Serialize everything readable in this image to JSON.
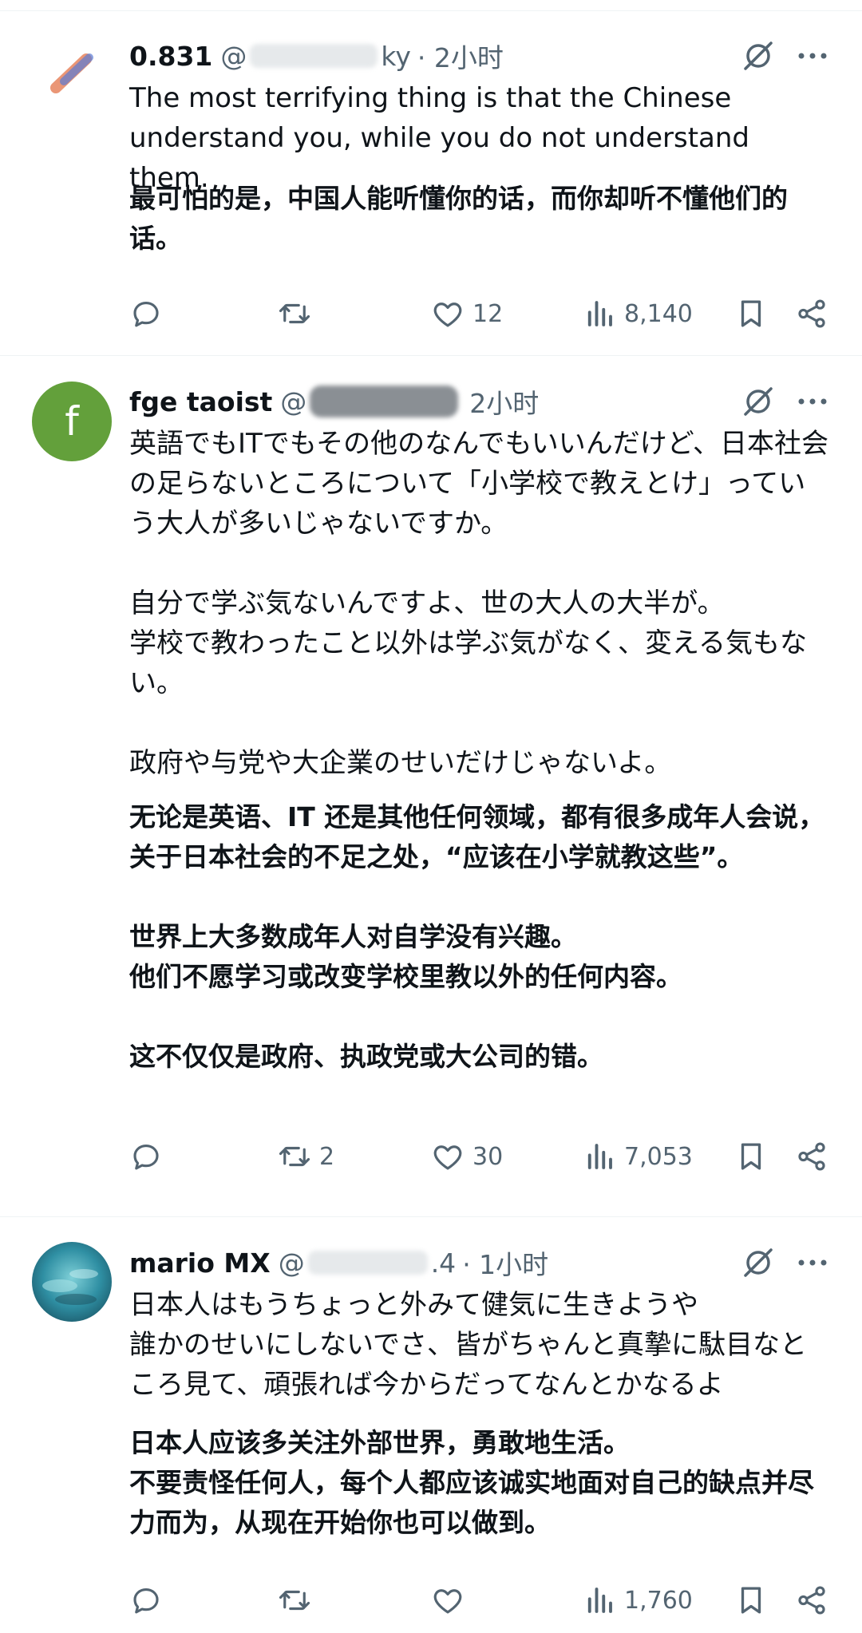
{
  "tweets": [
    {
      "name": "0.831",
      "handle": "@",
      "handle_tail": "ky",
      "time": "· 2小时",
      "original": "The most terrifying thing is that the Chinese understand you, while you do not understand them.",
      "translation": "最可怕的是，中国人能听懂你的话，而你却听不懂他们的话。",
      "stats": {
        "replies": "",
        "retweets": "",
        "likes": "12",
        "views": "8,140"
      },
      "avatar_color": "#e8eef7"
    },
    {
      "name": "fge taoist",
      "handle": "@",
      "handle_tail": "",
      "time": "2小时",
      "avatar_letter": "f",
      "original": "英語でもITでもその他のなんでもいいんだけど、日本社会の足らないところについて「小学校で教えとけ」っていう大人が多いじゃないですか。\n\n自分で学ぶ気ないんですよ、世の大人の大半が。\n学校で教わったこと以外は学ぶ気がなく、変える気もない。\n\n政府や与党や大企業のせいだけじゃないよ。",
      "translation": "无论是英语、IT 还是其他任何领域，都有很多成年人会说，关于日本社会的不足之处，“应该在小学就教这些”。\n\n世界上大多数成年人对自学没有兴趣。\n他们不愿学习或改变学校里教以外的任何内容。\n\n这不仅仅是政府、执政党或大公司的错。",
      "stats": {
        "replies": "",
        "retweets": "2",
        "likes": "30",
        "views": "7,053"
      },
      "avatar_color": "#63a03b"
    },
    {
      "name": "mario MX",
      "handle": "@",
      "handle_tail": ".4",
      "time": "· 1小时",
      "original": "日本人はもうちょっと外みて健気に生きようや\n誰かのせいにしないでさ、皆がちゃんと真摯に駄目なところ見て、頑張れば今からだってなんとかなるよ",
      "translation": "日本人应该多关注外部世界，勇敢地生活。\n不要责怪任何人，每个人都应该诚实地面对自己的缺点并尽力而为，从现在开始你也可以做到。",
      "stats": {
        "replies": "",
        "retweets": "",
        "likes": "",
        "views": "1,760"
      },
      "avatar_color": "#2f8fa3"
    }
  ],
  "icons": {
    "reply": "reply-icon",
    "retweet": "retweet-icon",
    "like": "like-icon",
    "views": "views-icon",
    "bookmark": "bookmark-icon",
    "share": "share-icon",
    "grok": "grok-icon",
    "more": "more-icon"
  }
}
